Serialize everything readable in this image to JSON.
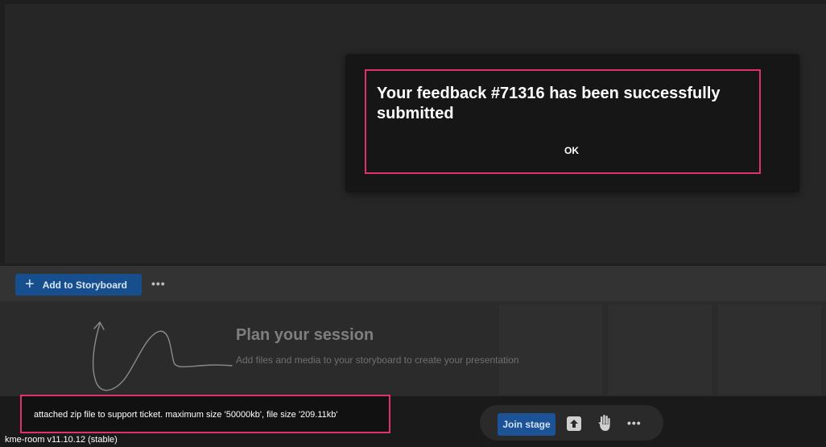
{
  "modal": {
    "message": "Your feedback #71316 has been successfully submitted",
    "ok_label": "OK"
  },
  "storyboard": {
    "add_label": "Add to Storyboard",
    "more_label": "•••",
    "empty_title": "Plan your session",
    "empty_subtitle": "Add files and media to your storyboard to create your presentation"
  },
  "controls": {
    "join_label": "Join stage",
    "more_label": "•••"
  },
  "toast": {
    "message": "attached zip file to support ticket. maximum size '50000kb', file size '209.11kb'"
  },
  "footer": {
    "version": "kme-room v11.10.12 (stable)"
  },
  "colors": {
    "highlight": "#e0306e",
    "primary_button": "#164e8e",
    "background": "#1f1f1f"
  }
}
